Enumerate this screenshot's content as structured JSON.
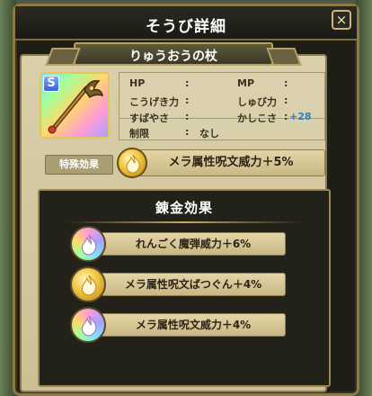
{
  "dialog": {
    "title": "そうび詳細",
    "close_label": "×"
  },
  "item": {
    "name": "りゅうおうの杖",
    "rank": "S",
    "icon": "staff-icon"
  },
  "stats": {
    "hp_label": "HP",
    "hp_value": "",
    "mp_label": "MP",
    "mp_value": "",
    "attack_label": "こうげき力",
    "attack_value": "",
    "defense_label": "しゅび力",
    "defense_value": "",
    "speed_label": "すばやさ",
    "speed_value": "",
    "wisdom_label": "かしこさ",
    "wisdom_value": "+28",
    "restriction_label": "制限",
    "restriction_value": "なし",
    "colon": ":"
  },
  "special_effect": {
    "label": "特殊効果",
    "text": "メラ属性呪文威力＋5%",
    "icon": "flame-icon"
  },
  "alchemy": {
    "title": "錬金効果",
    "effects": [
      {
        "text": "れんごく魔弾威力＋6%",
        "orb": "rainbow",
        "icon": "flame-icon"
      },
      {
        "text": "メラ属性呪文ばつぐん＋4%",
        "orb": "gold",
        "icon": "flame-icon"
      },
      {
        "text": "メラ属性呪文威力＋4%",
        "orb": "rainbow",
        "icon": "flame-icon"
      }
    ]
  },
  "colors": {
    "accent_gold": "#c9a85c",
    "parchment": "#d9cfa9",
    "stat_plus": "#2f7fc2"
  }
}
